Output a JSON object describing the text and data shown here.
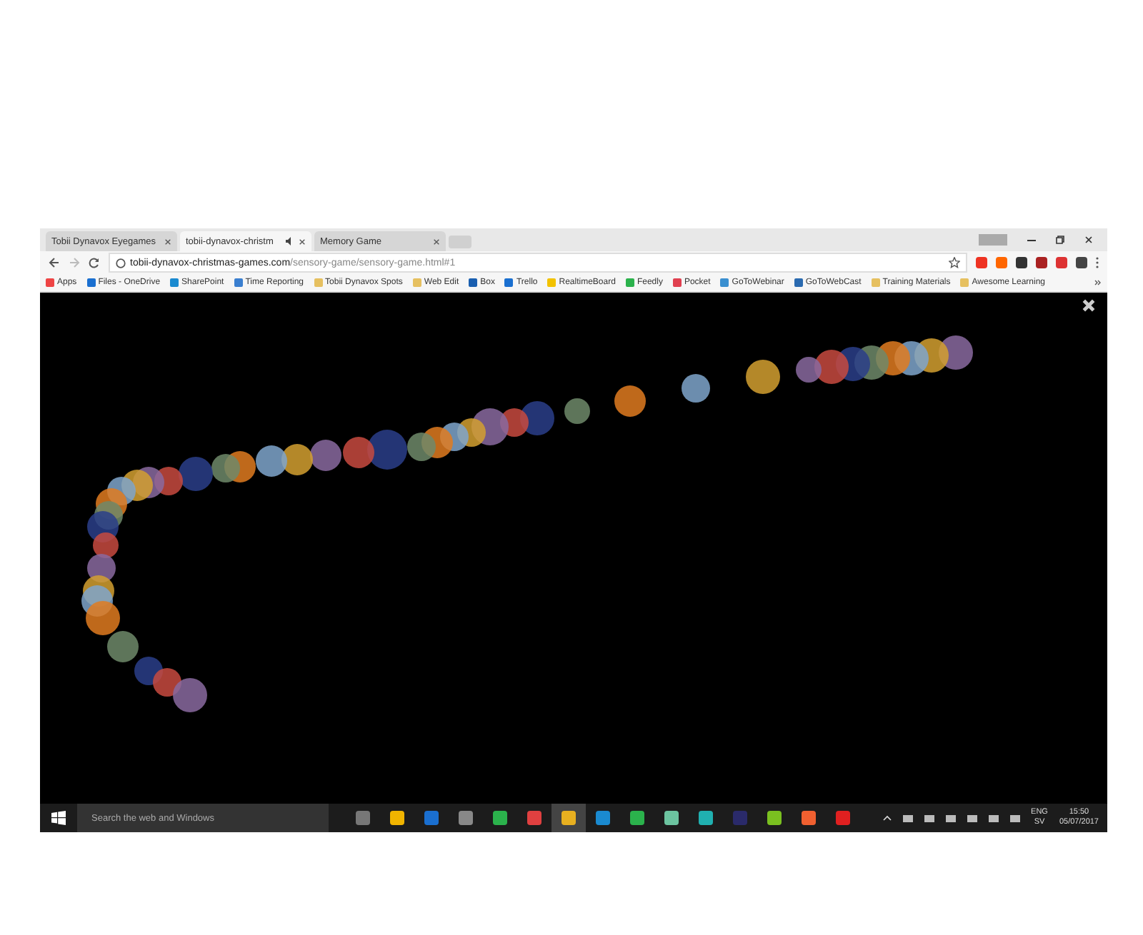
{
  "tabs": [
    {
      "title": "Tobii Dynavox Eyegames",
      "selected": false,
      "audio": false
    },
    {
      "title": "tobii-dynavox-christm",
      "selected": true,
      "audio": true
    },
    {
      "title": "Memory Game",
      "selected": false,
      "audio": false
    }
  ],
  "address": {
    "domain": "tobii-dynavox-christmas-games.com",
    "path": "/sensory-game/sensory-game.html#1"
  },
  "bookmarks": [
    "Apps",
    "Files - OneDrive",
    "SharePoint",
    "Time Reporting",
    "Tobii Dynavox Spots",
    "Web Edit",
    "Box",
    "Trello",
    "RealtimeBoard",
    "Feedly",
    "Pocket",
    "GoToWebinar",
    "GoToWebCast",
    "Training Materials",
    "Awesome Learning"
  ],
  "taskbar": {
    "search_placeholder": "Search the web and Windows",
    "language": "ENG",
    "layout": "SV",
    "time": "15:50",
    "date": "05/07/2017"
  }
}
